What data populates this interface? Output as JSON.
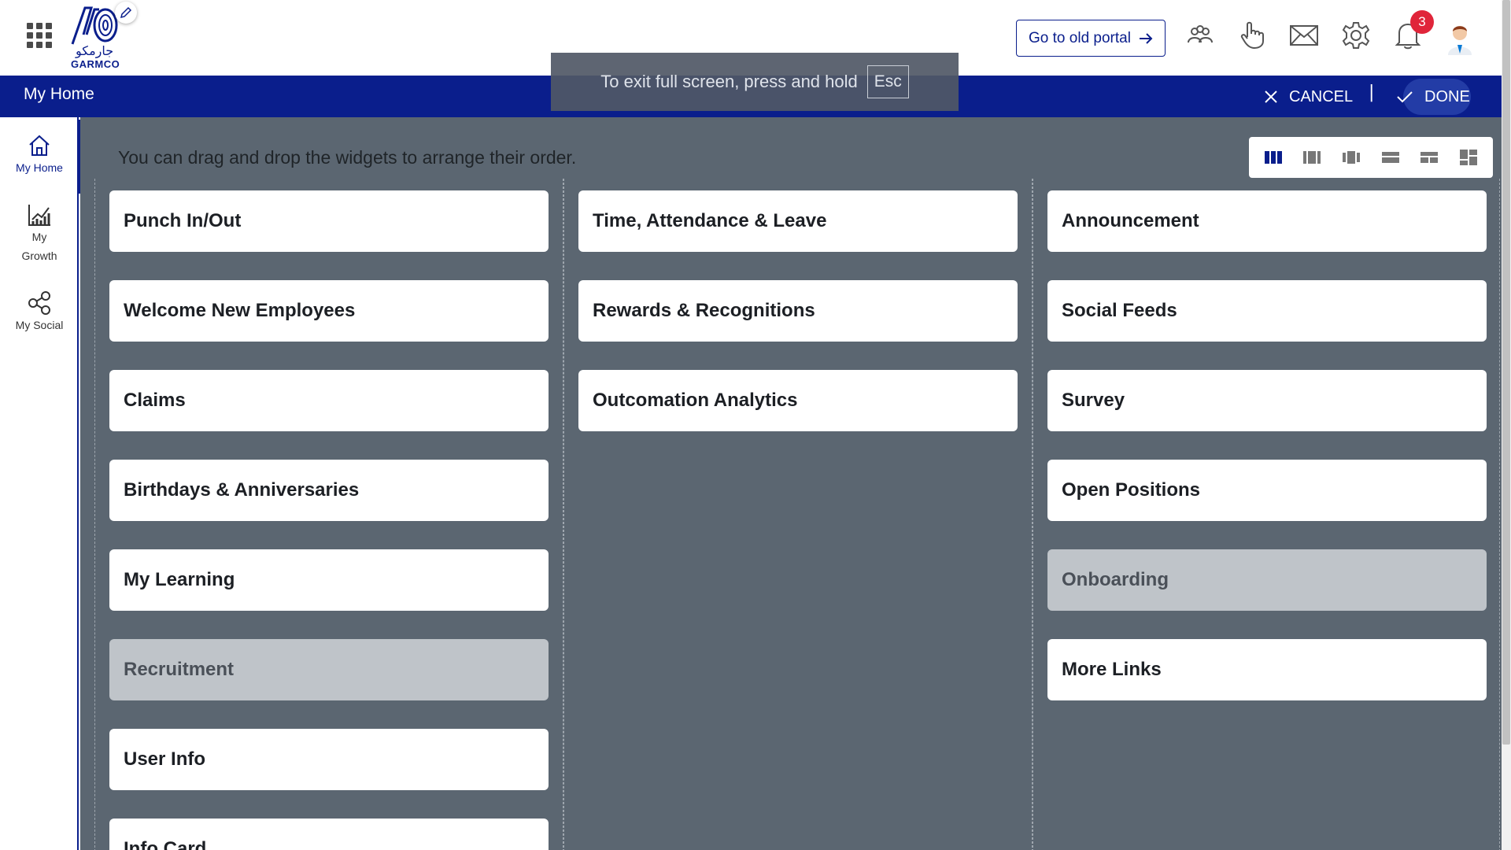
{
  "header": {
    "logo_text": "GARMCO",
    "logo_arabic": "جارمكو",
    "old_portal_label": "Go to old portal",
    "notification_count": "3"
  },
  "bar": {
    "title": "My Home",
    "cancel_label": "CANCEL",
    "separator": "|",
    "done_label": "DONE"
  },
  "toast": {
    "message": "To exit full screen, press and hold",
    "key": "Esc"
  },
  "sidebar": {
    "items": [
      {
        "label": "My Home",
        "icon": "home-icon"
      },
      {
        "label": "My Growth",
        "icon": "growth-chart-icon"
      },
      {
        "label": "My Social",
        "icon": "social-share-icon"
      }
    ]
  },
  "main": {
    "instruction": "You can drag and drop the widgets to arrange their order.",
    "layout_options": [
      "three-columns",
      "two-columns-wide-left",
      "two-columns-wide-center",
      "rows-layout",
      "mixed-layout-a",
      "grid-layout"
    ],
    "selected_layout": "three-columns",
    "columns": [
      {
        "widgets": [
          {
            "label": "Punch In/Out",
            "enabled": true
          },
          {
            "label": "Welcome New Employees",
            "enabled": true
          },
          {
            "label": "Claims",
            "enabled": true
          },
          {
            "label": "Birthdays & Anniversaries",
            "enabled": true
          },
          {
            "label": "My Learning",
            "enabled": true
          },
          {
            "label": "Recruitment",
            "enabled": false
          },
          {
            "label": "User Info",
            "enabled": true
          },
          {
            "label": "Info Card",
            "enabled": true
          }
        ]
      },
      {
        "widgets": [
          {
            "label": "Time, Attendance & Leave",
            "enabled": true
          },
          {
            "label": "Rewards & Recognitions",
            "enabled": true
          },
          {
            "label": "Outcomation Analytics",
            "enabled": true
          }
        ]
      },
      {
        "widgets": [
          {
            "label": "Announcement",
            "enabled": true
          },
          {
            "label": "Social Feeds",
            "enabled": true
          },
          {
            "label": "Survey",
            "enabled": true
          },
          {
            "label": "Open Positions",
            "enabled": true
          },
          {
            "label": "Onboarding",
            "enabled": false
          },
          {
            "label": "More Links",
            "enabled": true
          }
        ]
      }
    ]
  },
  "colors": {
    "brand": "#0a1e8c",
    "canvas": "#5b6671",
    "badge": "#e0253a",
    "disabled_widget": "#bfc4c9"
  }
}
